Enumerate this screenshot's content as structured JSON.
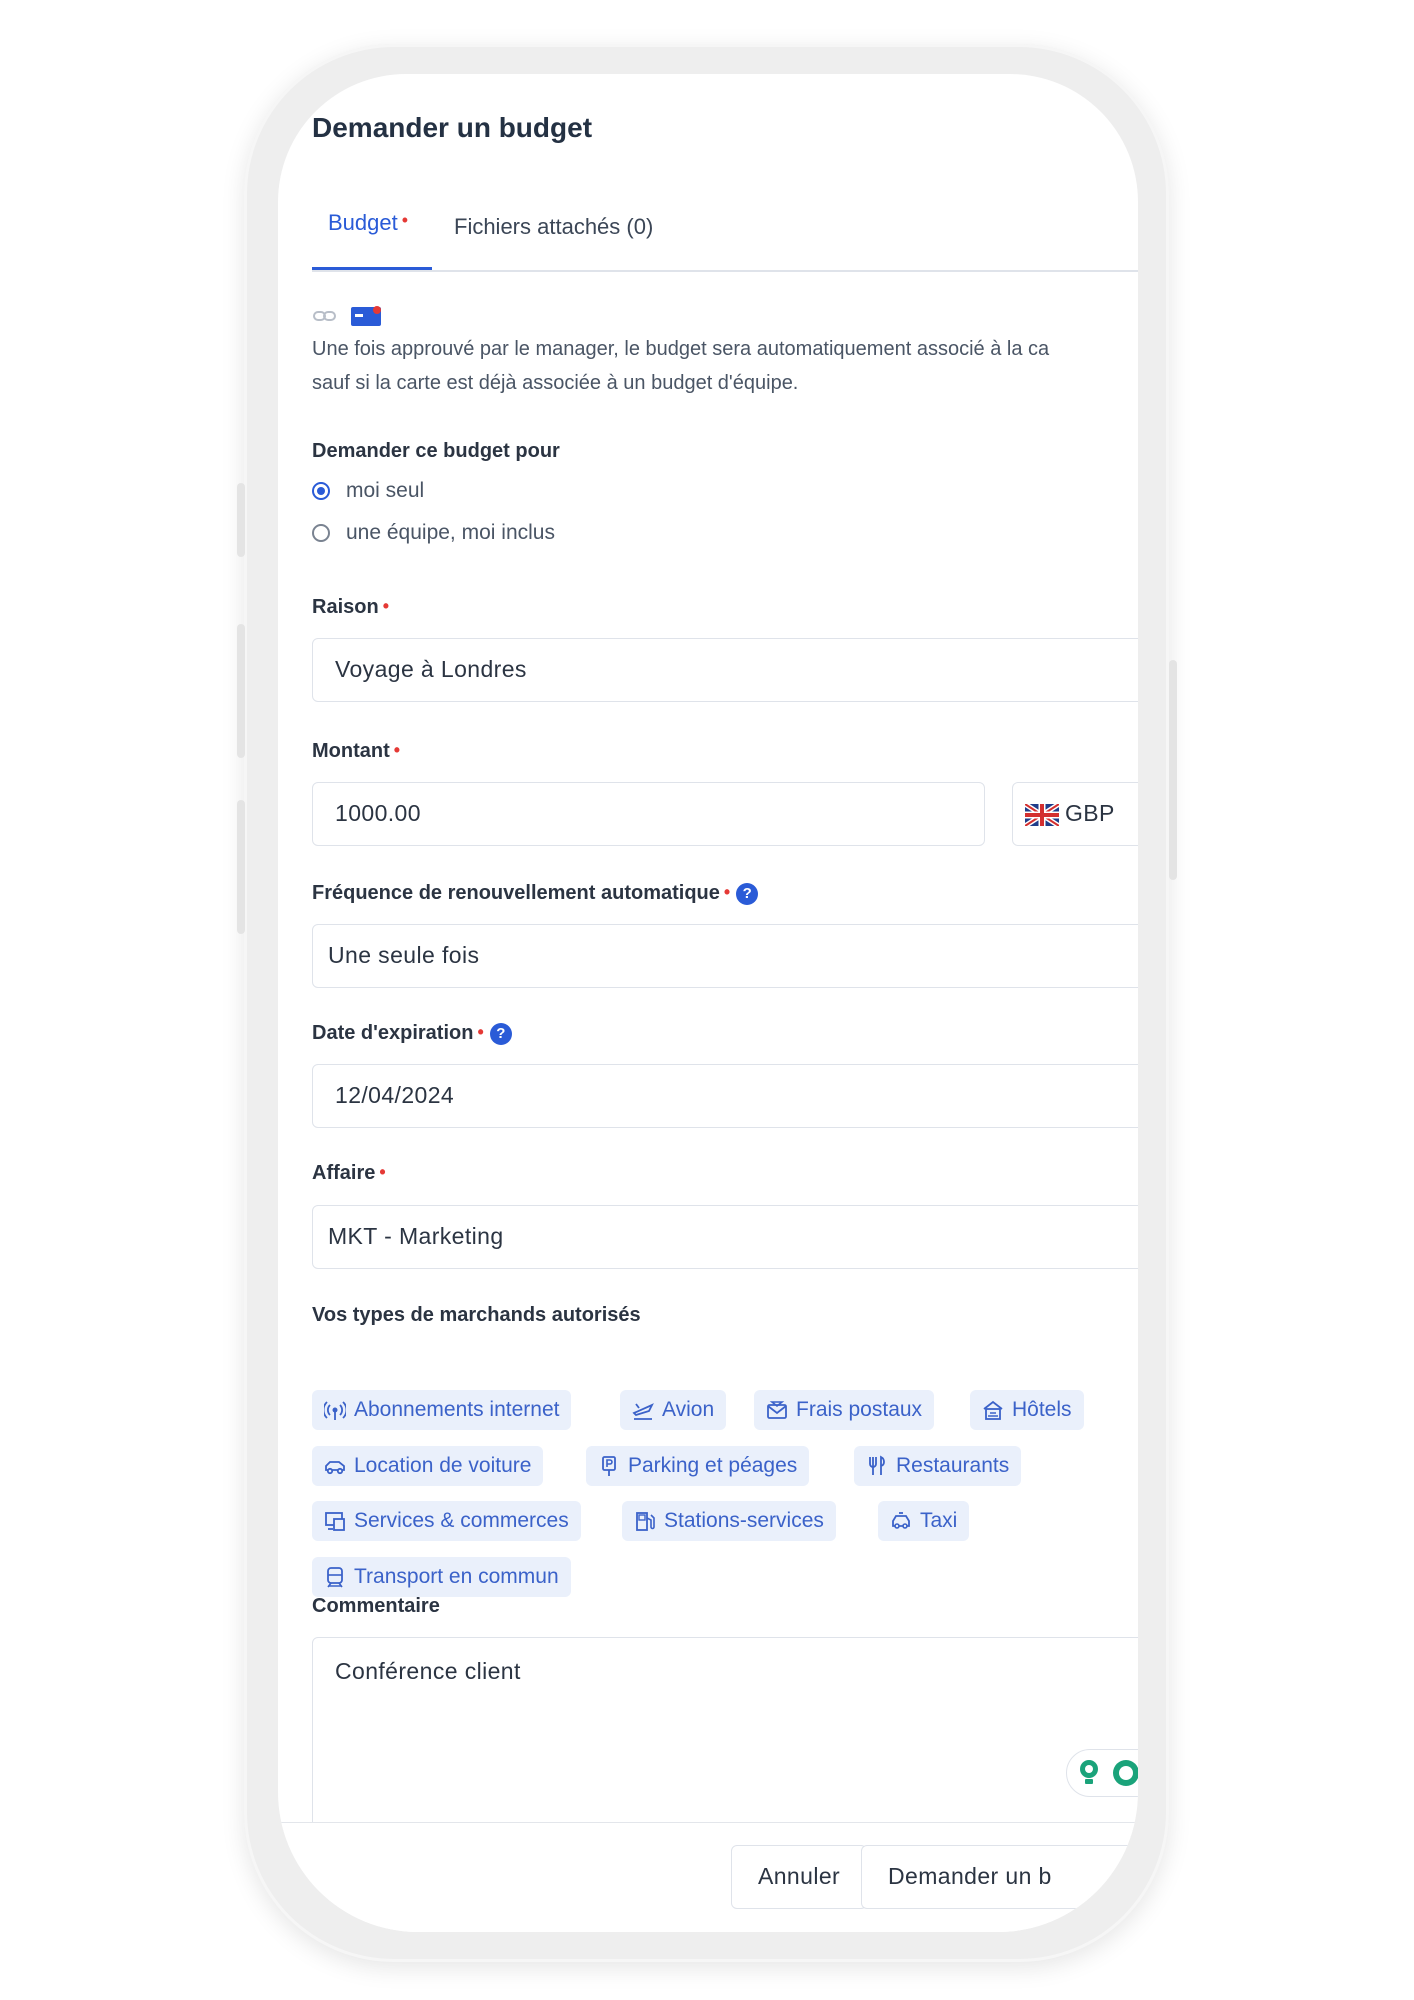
{
  "dialog": {
    "title": "Demander un budget"
  },
  "tabs": [
    {
      "label": "Budget",
      "required_mark": "•",
      "active": true
    },
    {
      "label": "Fichiers attachés (0)",
      "active": false
    }
  ],
  "info": {
    "icons": [
      "link-icon",
      "card-icon"
    ],
    "line1": "Une fois approuvé par le manager, le budget sera automatiquement associé à la ca",
    "line2": "sauf si la carte est déjà associée à un budget d'équipe."
  },
  "request_for": {
    "label": "Demander ce budget pour",
    "options": [
      {
        "label": "moi seul",
        "checked": true
      },
      {
        "label": "une équipe, moi inclus",
        "checked": false
      }
    ]
  },
  "reason": {
    "label": "Raison",
    "value": "Voyage à Londres"
  },
  "amount": {
    "label": "Montant",
    "value": "1000.00",
    "currency": "GBP",
    "currency_icon": "uk-flag-icon"
  },
  "frequency": {
    "label": "Fréquence de renouvellement automatique",
    "value": "Une seule fois",
    "help": "?"
  },
  "expiration": {
    "label": "Date d'expiration",
    "value": "12/04/2024",
    "help": "?"
  },
  "business": {
    "label": "Affaire",
    "value": "MKT - Marketing"
  },
  "merchants": {
    "label": "Vos types de marchands autorisés",
    "chips": [
      {
        "label": "Abonnements internet",
        "icon": "wifi-icon"
      },
      {
        "label": "Avion",
        "icon": "plane-icon"
      },
      {
        "label": "Frais postaux",
        "icon": "mail-icon"
      },
      {
        "label": "Hôtels",
        "icon": "hotel-icon"
      },
      {
        "label": "Location de voiture",
        "icon": "car-icon"
      },
      {
        "label": "Parking et péages",
        "icon": "parking-icon"
      },
      {
        "label": "Restaurants",
        "icon": "fork-knife-icon"
      },
      {
        "label": "Services & commerces",
        "icon": "shop-icon"
      },
      {
        "label": "Stations-services",
        "icon": "fuel-icon"
      },
      {
        "label": "Taxi",
        "icon": "taxi-icon"
      },
      {
        "label": "Transport en commun",
        "icon": "train-icon"
      }
    ]
  },
  "comment": {
    "label": "Commentaire",
    "value": "Conférence client"
  },
  "footer": {
    "cancel": "Annuler",
    "submit": "Demander un b"
  },
  "colors": {
    "accent": "#2a5bd7",
    "chip_bg": "#eaf0fb",
    "chip_text": "#3b62c9",
    "required": "#e53935"
  }
}
